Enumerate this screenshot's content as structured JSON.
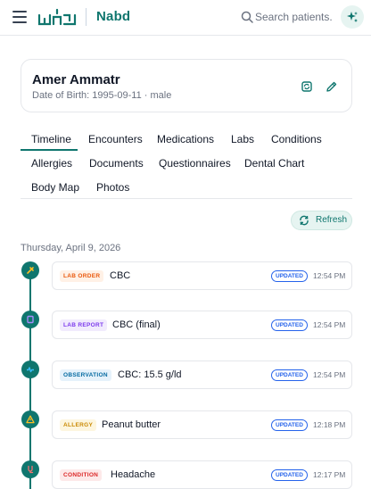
{
  "header": {
    "brand": "Nabd",
    "logo_name": "nabd-logo",
    "search_placeholder": "Search patients...",
    "ai_icon": "sparkles-icon"
  },
  "patient": {
    "name": "Amer Ammatr",
    "dob_line": "Date of Birth: 1995-09-11 · male"
  },
  "tabs": [
    "Timeline",
    "Encounters",
    "Medications",
    "Labs",
    "Conditions",
    "Allergies",
    "Documents",
    "Questionnaires",
    "Dental Chart",
    "Body Map",
    "Photos"
  ],
  "active_tab": "Timeline",
  "refresh_label": "Refresh",
  "date_heading": "Thursday, April 9, 2026",
  "events": [
    {
      "type": "LAB ORDER",
      "title": "CBC",
      "status": "UPDATED",
      "time": "12:54 PM",
      "type_color": "#ea580c",
      "type_bg": "#fff1e6",
      "icon": "flask-icon"
    },
    {
      "type": "LAB REPORT",
      "title": "CBC (final)",
      "status": "UPDATED",
      "time": "12:54 PM",
      "type_color": "#7c3aed",
      "type_bg": "#f1ebfd",
      "icon": "report-icon"
    },
    {
      "type": "OBSERVATION",
      "title": "CBC: 15.5 g/ld",
      "status": "UPDATED",
      "time": "12:54 PM",
      "type_color": "#0369a1",
      "type_bg": "#e6f2fb",
      "icon": "heartbeat-icon"
    },
    {
      "type": "ALLERGY",
      "title": "Peanut butter",
      "status": "UPDATED",
      "time": "12:18 PM",
      "type_color": "#ca8a04",
      "type_bg": "#fdf6df",
      "icon": "warning-icon"
    },
    {
      "type": "CONDITION",
      "title": "Headache",
      "status": "UPDATED",
      "time": "12:17 PM",
      "type_color": "#dc2626",
      "type_bg": "#fde9e9",
      "icon": "stethoscope-icon"
    }
  ],
  "colors": {
    "accent": "#0f766e",
    "status_blue": "#2563eb"
  }
}
